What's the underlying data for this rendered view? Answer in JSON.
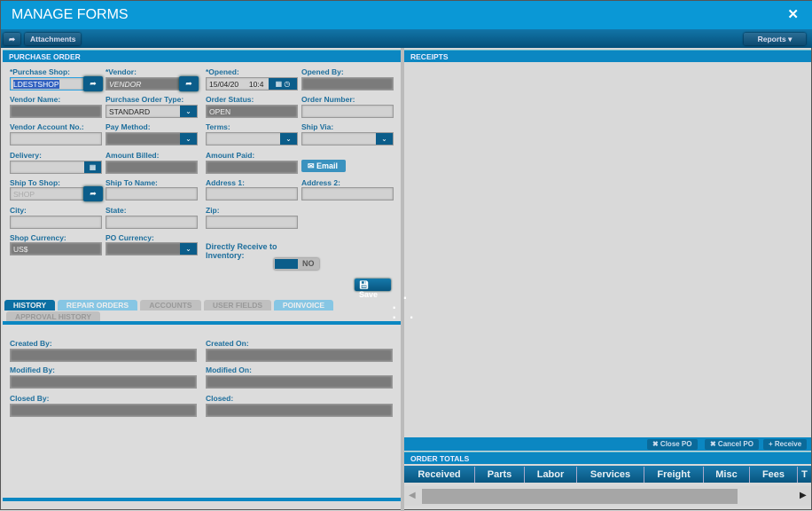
{
  "title": "MANAGE FORMS",
  "toolbar": {
    "attachments": "Attachments",
    "reports": "Reports"
  },
  "po": {
    "header": "PURCHASE ORDER",
    "purchase_shop_label": "*Purchase Shop:",
    "purchase_shop": "LDESTSHOP",
    "vendor_label": "*Vendor:",
    "vendor": "VENDOR",
    "opened_label": "*Opened:",
    "opened_date": "15/04/20",
    "opened_time": "10:4",
    "opened_by_label": "Opened By:",
    "vendor_name_label": "Vendor Name:",
    "po_type_label": "Purchase Order Type:",
    "po_type": "STANDARD",
    "order_status_label": "Order Status:",
    "order_status": "OPEN",
    "order_number_label": "Order Number:",
    "vendor_account_label": "Vendor Account No.:",
    "pay_method_label": "Pay Method:",
    "terms_label": "Terms:",
    "ship_via_label": "Ship Via:",
    "delivery_label": "Delivery:",
    "amount_billed_label": "Amount Billed:",
    "amount_paid_label": "Amount Paid:",
    "email": "Email",
    "ship_to_shop_label": "Ship To Shop:",
    "ship_to_shop_placeholder": "SHOP",
    "ship_to_name_label": "Ship To Name:",
    "address1_label": "Address 1:",
    "address2_label": "Address 2:",
    "city_label": "City:",
    "state_label": "State:",
    "zip_label": "Zip:",
    "shop_currency_label": "Shop Currency:",
    "shop_currency": "US$",
    "po_currency_label": "PO Currency:",
    "direct_receive_label": "Directly Receive to Inventory:",
    "direct_receive": "NO",
    "save": "Save"
  },
  "tabs": [
    "HISTORY",
    "REPAIR ORDERS",
    "ACCOUNTS",
    "USER FIELDS",
    "POINVOICE",
    "APPROVAL HISTORY"
  ],
  "history": {
    "created_by": "Created By:",
    "created_on": "Created On:",
    "modified_by": "Modified By:",
    "modified_on": "Modified On:",
    "closed_by": "Closed By:",
    "closed": "Closed:"
  },
  "receipts": {
    "header": "RECEIPTS",
    "close_po": "✖ Close PO",
    "cancel_po": "✖ Cancel PO",
    "receive": "+ Receive"
  },
  "order_totals": {
    "header": "ORDER TOTALS",
    "columns": [
      "Received",
      "Parts",
      "Labor",
      "Services",
      "Freight",
      "Misc",
      "Fees",
      "T"
    ]
  }
}
